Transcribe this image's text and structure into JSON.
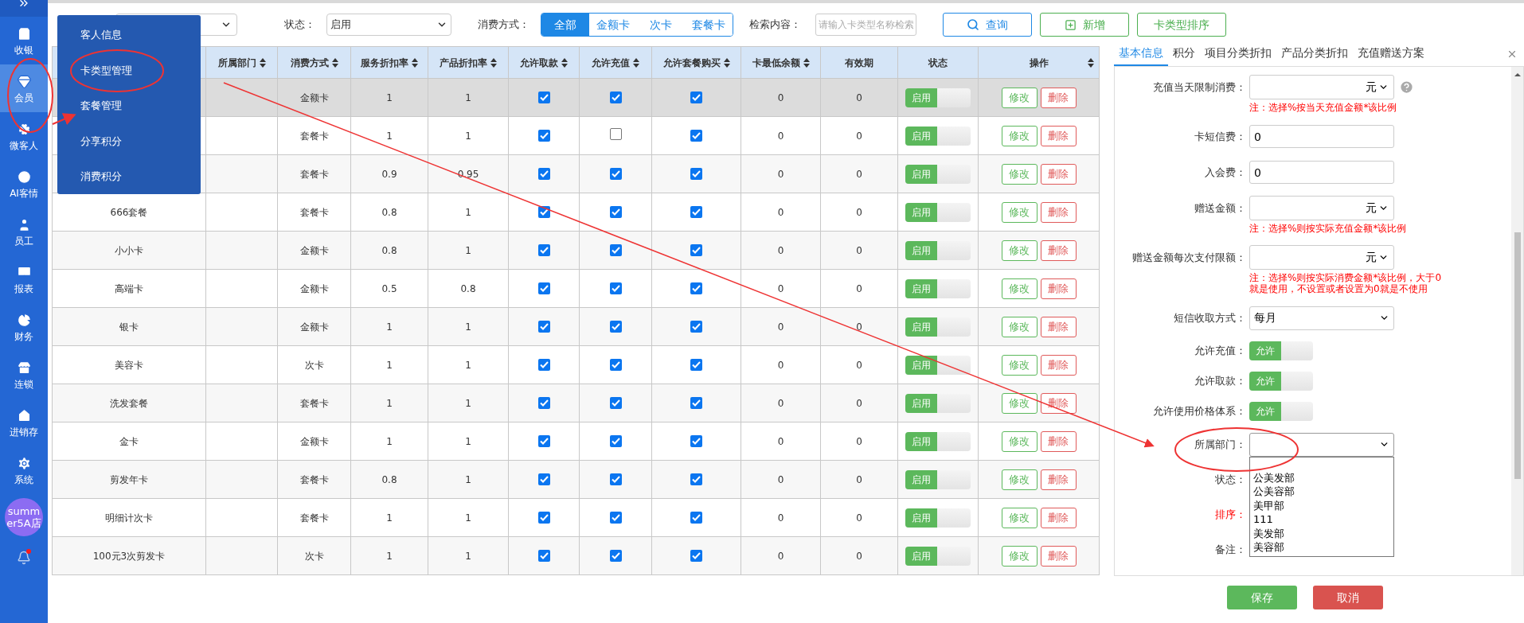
{
  "sidebar": {
    "items": [
      {
        "label": "收银",
        "selected": false
      },
      {
        "label": "会员",
        "selected": true
      },
      {
        "label": "微客人",
        "selected": false
      },
      {
        "label": "AI客情",
        "selected": false
      },
      {
        "label": "员工",
        "selected": false
      },
      {
        "label": "报表",
        "selected": false
      },
      {
        "label": "财务",
        "selected": false
      },
      {
        "label": "连锁",
        "selected": false
      },
      {
        "label": "进销存",
        "selected": false
      },
      {
        "label": "系统",
        "selected": false
      }
    ],
    "store": "summer5A店",
    "notification": true
  },
  "submenu": [
    "客人信息",
    "卡类型管理",
    "套餐管理",
    "分享积分",
    "消费积分"
  ],
  "filters": {
    "status_label": "状态：",
    "status_value": "启用",
    "method_label": "消费方式：",
    "methods": [
      {
        "label": "全部",
        "selected": true
      },
      {
        "label": "金额卡",
        "selected": false
      },
      {
        "label": "次卡",
        "selected": false
      },
      {
        "label": "套餐卡",
        "selected": false
      }
    ],
    "search_label": "检索内容：",
    "search_placeholder": "请输入卡类型名称检索",
    "buttons": [
      {
        "kind": "search",
        "label": "查询"
      },
      {
        "kind": "add",
        "label": "新增"
      },
      {
        "kind": "plain",
        "label": "卡类型排序"
      }
    ]
  },
  "table": {
    "columns": [
      {
        "label": "所属部门",
        "sortable": true
      },
      {
        "label": "消费方式",
        "sortable": true
      },
      {
        "label": "服务折扣率",
        "sortable": true
      },
      {
        "label": "产品折扣率",
        "sortable": true
      },
      {
        "label": "允许取款",
        "sortable": true
      },
      {
        "label": "允许充值",
        "sortable": true
      },
      {
        "label": "允许套餐购买",
        "sortable": true
      },
      {
        "label": "卡最低余额",
        "sortable": true
      },
      {
        "label": "有效期",
        "sortable": false
      },
      {
        "label": "状态",
        "sortable": false
      },
      {
        "label": "操作",
        "sortable": true
      }
    ],
    "rows": [
      {
        "selected": true,
        "method": "金额卡",
        "service_rate": "1",
        "product_rate": "1",
        "allow_withdraw": true,
        "allow_recharge": true,
        "allow_package": true,
        "min_balance": "0",
        "validity": "0",
        "status": {
          "text": "启用",
          "on": true
        },
        "actions": [
          "修改",
          "删除"
        ]
      },
      {
        "selected": false,
        "method": "套餐卡",
        "service_rate": "1",
        "product_rate": "1",
        "allow_withdraw": true,
        "allow_recharge": false,
        "allow_package": true,
        "min_balance": "0",
        "validity": "0",
        "status": {
          "text": "启用",
          "on": true
        },
        "actions": [
          "修改",
          "删除"
        ]
      },
      {
        "selected": false,
        "method": "套餐卡",
        "service_rate": "0.9",
        "product_rate": "0.95",
        "allow_withdraw": true,
        "allow_recharge": true,
        "allow_package": true,
        "min_balance": "0",
        "validity": "0",
        "status": {
          "text": "启用",
          "on": true
        },
        "actions": [
          "修改",
          "删除"
        ]
      },
      {
        "selected": false,
        "name": "666套餐",
        "method": "套餐卡",
        "service_rate": "0.8",
        "product_rate": "1",
        "allow_withdraw": true,
        "allow_recharge": true,
        "allow_package": true,
        "min_balance": "0",
        "validity": "0",
        "status": {
          "text": "启用",
          "on": true
        },
        "actions": [
          "修改",
          "删除"
        ]
      },
      {
        "selected": false,
        "name": "小小卡",
        "method": "金额卡",
        "service_rate": "0.8",
        "product_rate": "1",
        "allow_withdraw": true,
        "allow_recharge": true,
        "allow_package": true,
        "min_balance": "0",
        "validity": "0",
        "status": {
          "text": "启用",
          "on": true
        },
        "actions": [
          "修改",
          "删除"
        ]
      },
      {
        "selected": false,
        "name": "高端卡",
        "method": "金额卡",
        "service_rate": "0.5",
        "product_rate": "0.8",
        "allow_withdraw": true,
        "allow_recharge": true,
        "allow_package": true,
        "min_balance": "0",
        "validity": "0",
        "status": {
          "text": "启用",
          "on": true
        },
        "actions": [
          "修改",
          "删除"
        ]
      },
      {
        "selected": false,
        "name": "银卡",
        "method": "金额卡",
        "service_rate": "1",
        "product_rate": "1",
        "allow_withdraw": true,
        "allow_recharge": true,
        "allow_package": true,
        "min_balance": "0",
        "validity": "0",
        "status": {
          "text": "启用",
          "on": true
        },
        "actions": [
          "修改",
          "删除"
        ]
      },
      {
        "selected": false,
        "name": "美容卡",
        "method": "次卡",
        "service_rate": "1",
        "product_rate": "1",
        "allow_withdraw": true,
        "allow_recharge": true,
        "allow_package": true,
        "min_balance": "0",
        "validity": "0",
        "status": {
          "text": "启用",
          "on": true
        },
        "actions": [
          "修改",
          "删除"
        ]
      },
      {
        "selected": false,
        "name": "洗发套餐",
        "method": "套餐卡",
        "service_rate": "1",
        "product_rate": "1",
        "allow_withdraw": true,
        "allow_recharge": true,
        "allow_package": true,
        "min_balance": "0",
        "validity": "0",
        "status": {
          "text": "启用",
          "on": true
        },
        "actions": [
          "修改",
          "删除"
        ]
      },
      {
        "selected": false,
        "name": "金卡",
        "method": "金额卡",
        "service_rate": "1",
        "product_rate": "1",
        "allow_withdraw": true,
        "allow_recharge": true,
        "allow_package": true,
        "min_balance": "0",
        "validity": "0",
        "status": {
          "text": "启用",
          "on": true
        },
        "actions": [
          "修改",
          "删除"
        ]
      },
      {
        "selected": false,
        "name": "剪发年卡",
        "method": "套餐卡",
        "service_rate": "0.8",
        "product_rate": "1",
        "allow_withdraw": true,
        "allow_recharge": true,
        "allow_package": true,
        "min_balance": "0",
        "validity": "0",
        "status": {
          "text": "启用",
          "on": true
        },
        "actions": [
          "修改",
          "删除"
        ]
      },
      {
        "selected": false,
        "name": "明细计次卡",
        "method": "套餐卡",
        "service_rate": "1",
        "product_rate": "1",
        "allow_withdraw": true,
        "allow_recharge": true,
        "allow_package": true,
        "min_balance": "0",
        "validity": "0",
        "status": {
          "text": "启用",
          "on": true
        },
        "actions": [
          "修改",
          "删除"
        ]
      },
      {
        "selected": false,
        "name": "100元3次剪发卡",
        "method": "次卡",
        "service_rate": "1",
        "product_rate": "1",
        "allow_withdraw": true,
        "allow_recharge": true,
        "allow_package": true,
        "min_balance": "0",
        "validity": "0",
        "status": {
          "text": "启用",
          "on": true
        },
        "actions": [
          "修改",
          "删除"
        ]
      }
    ]
  },
  "panel": {
    "tabs": [
      {
        "label": "基本信息",
        "selected": true
      },
      {
        "label": "积分",
        "selected": false
      },
      {
        "label": "项目分类折扣",
        "selected": false
      },
      {
        "label": "产品分类折扣",
        "selected": false
      },
      {
        "label": "充值赠送方案",
        "selected": false
      }
    ],
    "fields": [
      {
        "kind": "unit-select",
        "label": "充值当天限制消费：",
        "value": "元",
        "help": true,
        "note": "注：选择%按当天充值金额*该比例"
      },
      {
        "kind": "input",
        "label": "卡短信费：",
        "value": "0"
      },
      {
        "kind": "input",
        "label": "入会费：",
        "value": "0"
      },
      {
        "kind": "unit-select",
        "label": "赠送金额：",
        "value": "元",
        "note": "注：选择%则按实际充值金额*该比例"
      },
      {
        "kind": "unit-select",
        "label": "赠送金额每次支付限额：",
        "value": "元",
        "note": "注：选择%则按实际消费金额*该比例，大于0 就是使用，不设置或者设置为0就是不使用"
      },
      {
        "kind": "select",
        "label": "短信收取方式：",
        "value": "每月"
      },
      {
        "kind": "toggle",
        "label": "允许充值：",
        "text": "允许",
        "on": true
      },
      {
        "kind": "toggle",
        "label": "允许取款：",
        "text": "允许",
        "on": true
      },
      {
        "kind": "toggle",
        "label": "允许使用价格体系：",
        "text": "允许",
        "on": true
      },
      {
        "kind": "select",
        "label": "所属部门：",
        "expanded": true,
        "options": [
          "公美发部",
          "公美容部",
          "美甲部",
          "111",
          "美发部",
          "美容部"
        ]
      },
      {
        "kind": "label",
        "label": "状态：",
        "required": false
      },
      {
        "kind": "label",
        "label": "排序：",
        "required": true
      },
      {
        "kind": "label",
        "label": "备注：",
        "required": false
      }
    ],
    "buttons": [
      {
        "kind": "save",
        "label": "保存"
      },
      {
        "kind": "cancel",
        "label": "取消"
      }
    ]
  }
}
